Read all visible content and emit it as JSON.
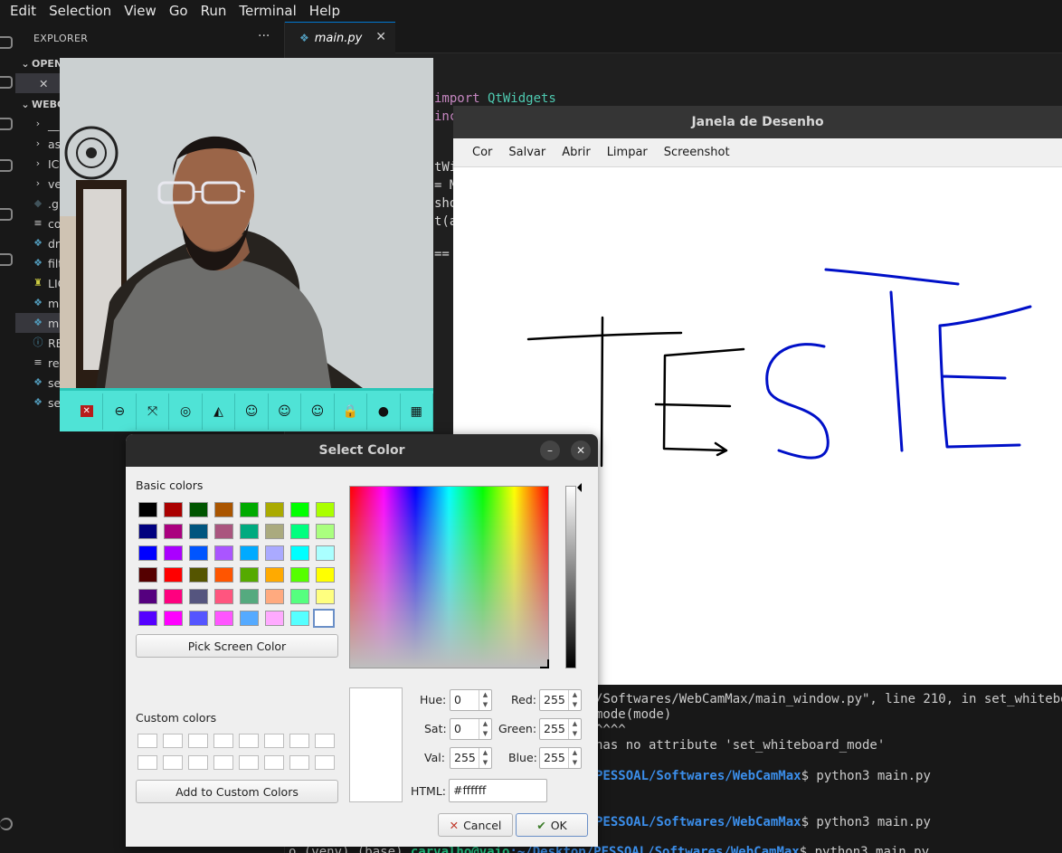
{
  "vscode": {
    "menu": [
      "Edit",
      "Selection",
      "View",
      "Go",
      "Run",
      "Terminal",
      "Help"
    ],
    "explorer_title": "EXPLORER",
    "explorer_more": "···",
    "open_editors_label": "OPEN",
    "workspace_label": "WEBC",
    "files": [
      {
        "label": "__",
        "kind": "folder"
      },
      {
        "label": "ass",
        "kind": "folder"
      },
      {
        "label": "ICC",
        "kind": "folder"
      },
      {
        "label": "ver",
        "kind": "folder"
      },
      {
        "label": ".gi",
        "kind": "git"
      },
      {
        "label": "col",
        "kind": "file"
      },
      {
        "label": "dra",
        "kind": "python"
      },
      {
        "label": "filt",
        "kind": "python"
      },
      {
        "label": "LIC",
        "kind": "license"
      },
      {
        "label": "ma",
        "kind": "python"
      },
      {
        "label": "ma",
        "kind": "python"
      },
      {
        "label": "RE",
        "kind": "info"
      },
      {
        "label": "req",
        "kind": "file"
      },
      {
        "label": "sec",
        "kind": "python"
      },
      {
        "label": "set",
        "kind": "python"
      }
    ],
    "tab": {
      "label": "main.py",
      "close": "✕"
    },
    "code_lines": [
      {
        "kw": "import",
        "rest": " QtWidgets"
      },
      {
        "kw": "inc",
        "rest": ""
      },
      {
        "kw": "",
        "rest": "tWi"
      },
      {
        "kw": "",
        "rest": "= M"
      },
      {
        "kw": "",
        "rest": "sho"
      },
      {
        "kw": "",
        "rest": "t(a"
      },
      {
        "kw": "",
        "rest": "=="
      }
    ],
    "terminal": [
      {
        "prefix": "",
        "path": "",
        "text": "/Softwares/WebCamMax/main_window.py\", line 210, in set_whitebo"
      },
      {
        "prefix": "",
        "path": "",
        "text": "mode(mode)"
      },
      {
        "prefix": "",
        "path": "",
        "text": "^^^^"
      },
      {
        "prefix": "",
        "path": "",
        "text": "has no attribute 'set_whiteboard_mode'"
      },
      {
        "prefix": "",
        "path": "PESSOAL/Softwares/WebCamMax",
        "text": "$ python3 main.py"
      },
      {
        "prefix": "",
        "path": "PESSOAL/Softwares/WebCamMax",
        "text": "$ python3 main.py"
      },
      {
        "prefix": "o (venv) (base) ",
        "user": "carvalho@vaio",
        "path": ":~/Desktop/PESSOAL/Softwares/WebCamMax",
        "text": "$ python3 main.py"
      }
    ]
  },
  "webcam": {
    "toolbar": [
      "close-box-icon",
      "minus-circle-icon",
      "expand-icon",
      "eye-off-icon",
      "mirror-icon",
      "face1-icon",
      "face2-icon",
      "face3-icon",
      "lock-icon",
      "shapes-icon",
      "grid-icon"
    ],
    "toolbar_glyphs": [
      "✕",
      "⊖",
      "⤧",
      "◎",
      "◭",
      "☺",
      "☺",
      "☺",
      "🔒",
      "●",
      "▦"
    ]
  },
  "drawing": {
    "title": "Janela de Desenho",
    "menu": [
      "Cor",
      "Salvar",
      "Abrir",
      "Limpar",
      "Screenshot"
    ]
  },
  "color_dialog": {
    "title": "Select Color",
    "minimize": "–",
    "close": "✕",
    "basic_colors_label": "Basic colors",
    "basic_colors": [
      [
        "#000000",
        "#aa0000",
        "#005500",
        "#aa5500",
        "#00aa00",
        "#aaaa00",
        "#00ff00",
        "#aaff00"
      ],
      [
        "#00007f",
        "#aa007f",
        "#00557f",
        "#aa557f",
        "#00aa7f",
        "#aaaa7f",
        "#00ff7f",
        "#aaff7f"
      ],
      [
        "#0000ff",
        "#aa00ff",
        "#0055ff",
        "#aa55ff",
        "#00aaff",
        "#aaaaff",
        "#00ffff",
        "#aaffff"
      ],
      [
        "#550000",
        "#ff0000",
        "#555500",
        "#ff5500",
        "#55aa00",
        "#ffaa00",
        "#55ff00",
        "#ffff00"
      ],
      [
        "#55007f",
        "#ff007f",
        "#55557f",
        "#ff557f",
        "#55aa7f",
        "#ffaa7f",
        "#55ff7f",
        "#ffff7f"
      ],
      [
        "#5500ff",
        "#ff00ff",
        "#5555ff",
        "#ff55ff",
        "#55aaff",
        "#ffaaff",
        "#55ffff",
        "#ffffff"
      ]
    ],
    "pick_screen_color": "Pick Screen Color",
    "custom_colors_label": "Custom colors",
    "add_custom": "Add to Custom Colors",
    "fields": {
      "hue": {
        "label": "Hue:",
        "value": "0"
      },
      "sat": {
        "label": "Sat:",
        "value": "0"
      },
      "val": {
        "label": "Val:",
        "value": "255"
      },
      "red": {
        "label": "Red:",
        "value": "255"
      },
      "green": {
        "label": "Green:",
        "value": "255"
      },
      "blue": {
        "label": "Blue:",
        "value": "255"
      },
      "html": {
        "label": "HTML:",
        "value": "#ffffff"
      }
    },
    "cancel": "Cancel",
    "ok": "OK",
    "selected_color": "#ffffff"
  }
}
